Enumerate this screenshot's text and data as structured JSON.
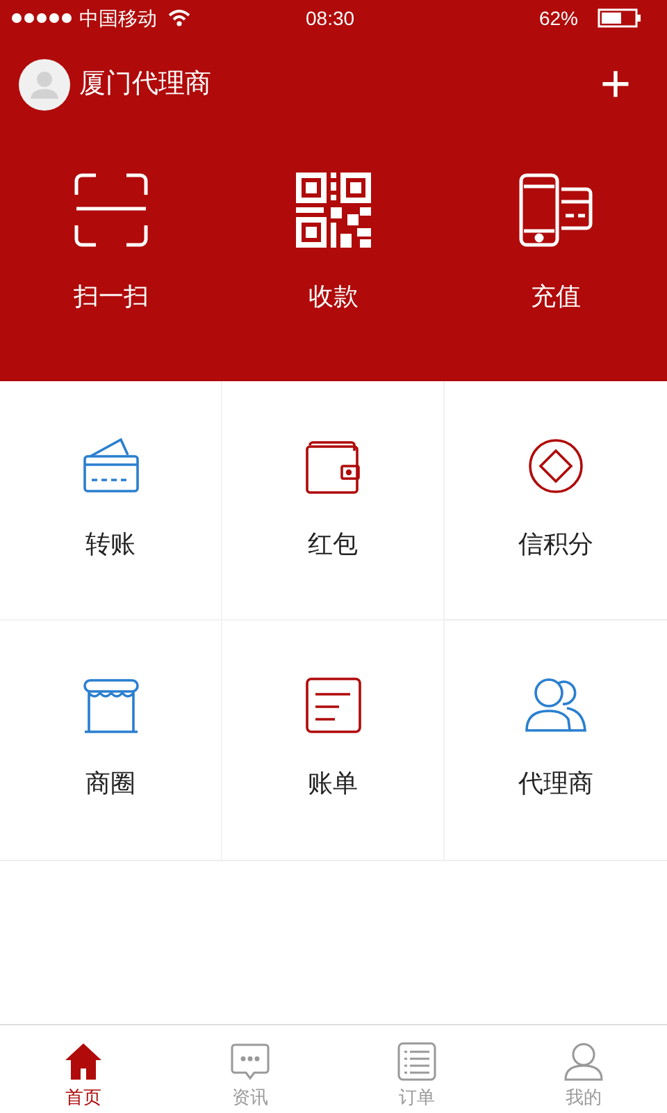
{
  "status_bar": {
    "carrier": "中国移动",
    "time": "08:30",
    "battery": "62%"
  },
  "header": {
    "title": "厦门代理商",
    "add": "+"
  },
  "quick_actions": [
    {
      "label": "扫一扫"
    },
    {
      "label": "收款"
    },
    {
      "label": "充值"
    }
  ],
  "grid": [
    {
      "label": "转账"
    },
    {
      "label": "红包"
    },
    {
      "label": "信积分"
    },
    {
      "label": "商圈"
    },
    {
      "label": "账单"
    },
    {
      "label": "代理商"
    }
  ],
  "tabs": [
    {
      "label": "首页",
      "selected": true
    },
    {
      "label": "资讯",
      "selected": false
    },
    {
      "label": "订单",
      "selected": false
    },
    {
      "label": "我的",
      "selected": false
    }
  ]
}
